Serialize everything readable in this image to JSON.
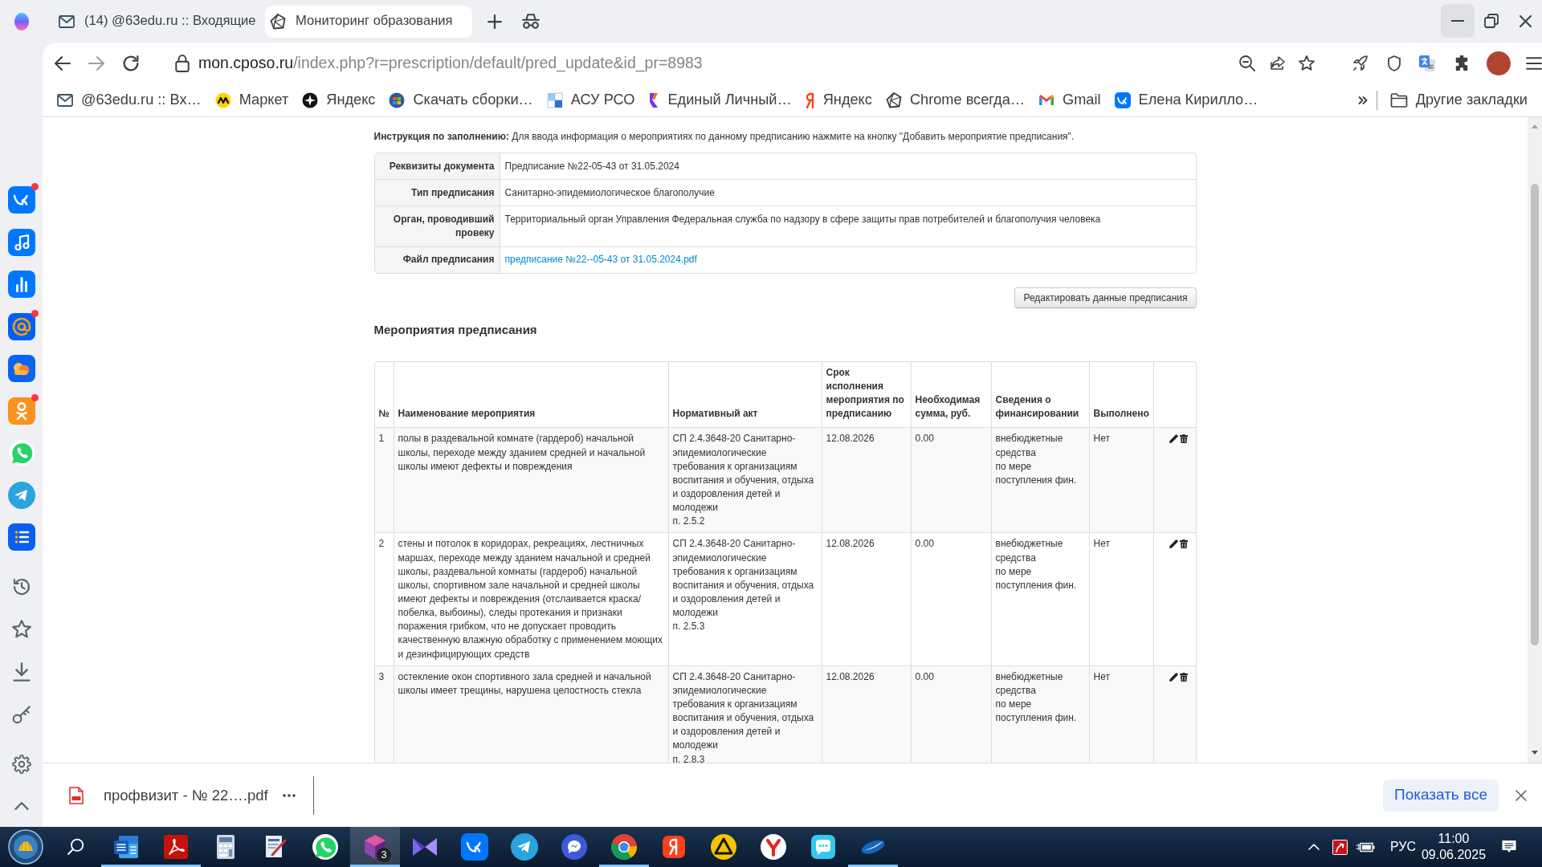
{
  "browser": {
    "tabs": [
      {
        "title": "(14) @63edu.ru :: Входящие",
        "kind": "envelope",
        "selected": false
      },
      {
        "title": "Мониторинг образования",
        "kind": "polyhedron",
        "selected": true
      }
    ],
    "window_controls": [
      {
        "kind": "minimize",
        "hovered": true
      },
      {
        "kind": "restore",
        "hovered": false
      },
      {
        "kind": "close",
        "hovered": false
      }
    ],
    "address": {
      "host": "mon.cposo.ru",
      "path": "/index.php?r=prescription/default/pred_update&id_pr=8983"
    },
    "bookmarks": [
      {
        "label": "@63edu.ru :: Вх…",
        "kind": "envelope"
      },
      {
        "label": "Маркет",
        "kind": "zigzag"
      },
      {
        "label": "Яндекс",
        "kind": "compass"
      },
      {
        "label": "Скачать сборки…",
        "kind": "globe"
      },
      {
        "label": "АСУ РСО",
        "kind": "squares"
      },
      {
        "label": "Единый Личный…",
        "kind": "ribbon"
      },
      {
        "label": "Яндекс",
        "kind": "loop"
      },
      {
        "label": "Chrome всегда…",
        "kind": "polyhedron"
      },
      {
        "label": "Gmail",
        "kind": "mail"
      },
      {
        "label": "Елена Кирилло…",
        "kind": "logo"
      }
    ],
    "other_bookmarks": "Другие закладки"
  },
  "sidebar": {
    "apps": [
      {
        "kind": "logo",
        "notification": true
      },
      {
        "kind": "note",
        "notification": false
      },
      {
        "kind": "bars",
        "notification": false
      },
      {
        "kind": "at",
        "notification": true
      },
      {
        "kind": "clouds",
        "notification": false
      },
      {
        "kind": "person",
        "notification": true
      },
      {
        "kind": "phone",
        "notification": false
      },
      {
        "kind": "plane",
        "notification": false
      },
      {
        "kind": "list",
        "notification": false
      }
    ]
  },
  "page": {
    "instruction": "**Инструкция по заполнению:** Для ввода информация о мероприятиях по данному предписанию нажмите на кнопку \"Добавить мероприятие предписания\".",
    "details": [
      {
        "label": "Реквизиты документа",
        "value": "Предписание №22-05-43 от 31.05.2024",
        "kind": "text"
      },
      {
        "label": "Тип предписания",
        "value": "Санитарно-эпидемиологическое благополучие",
        "kind": "text"
      },
      {
        "label": "Орган, проводивший провеку",
        "value": "Территориальный орган Управления Федеральная служба по надзору в сфере защиты прав потребителей и благополучия человека",
        "kind": "text"
      },
      {
        "label": "Файл предписания",
        "value": "предписание №22--05-43 от 31.05.2024.pdf",
        "kind": "link"
      }
    ],
    "edit_button": "Редактировать данные предписания",
    "events": {
      "title": "Мероприятия предписания",
      "columns": [
        "№",
        "Наименование мероприятия",
        "Нормативный акт",
        "Срок исполнения мероприятия по предписанию",
        "Необходимая сумма, руб.",
        "Сведения о финансировании",
        "Выполнено"
      ],
      "rows": [
        {
          "number": "1",
          "name": "полы в раздевальной комнате (гардероб) начальной школы, переходе между зданием средней и начальной школы имеют дефекты и повреждения",
          "act": "СП 2.4.3648-20 Санитарно-эпидемиологические требования к организациям воспитания и обучения, отдыха и оздоровления детей и молодежи",
          "clause": "п. 2.5.2",
          "deadline": "12.08.2026",
          "amount": "0.00",
          "funding": "внебюджетные средства",
          "funding_note": "по мере поступления фин.",
          "done": "Нет"
        },
        {
          "number": "2",
          "name": "стены и потолок в коридорах, рекреациях, лестничных маршах, переходе между зданием начальной и средней школы, раздевальной комнаты (гардероб) начальной школы, спортивном зале начальной и средней школы имеют дефекты и повреждения (отслаивается краска/побелка, выбоины), следы протекания и признаки поражения грибком, что не допускает проводить качественную влажную обработку с применением моющих и дезинфицирующих средств",
          "act": "СП 2.4.3648-20 Санитарно-эпидемиологические требования к организациям воспитания и обучения, отдыха и оздоровления детей и молодежи",
          "clause": "п. 2.5.3",
          "deadline": "12.08.2026",
          "amount": "0.00",
          "funding": "внебюджетные средства",
          "funding_note": "по мере поступления фин.",
          "done": "Нет"
        },
        {
          "number": "3",
          "name": "остекление окон спортивного зала средней и начальной школы имеет трещины, нарушена целостность стекла",
          "act": "СП 2.4.3648-20 Санитарно-эпидемиологические требования к организациям воспитания и обучения, отдыха и оздоровления детей и молодежи",
          "clause": "п. 2.8.3",
          "deadline": "12.08.2026",
          "amount": "0.00",
          "funding": "внебюджетные средства",
          "funding_note": "по мере поступления фин.",
          "done": "Нет"
        }
      ]
    }
  },
  "download_bar": {
    "file": "профвизит - № 22….pdf",
    "show_all": "Показать все"
  },
  "taskbar": {
    "apps": [
      {
        "kind": "document",
        "running": true,
        "selected": false
      },
      {
        "kind": "swirl",
        "running": true,
        "selected": false
      },
      {
        "kind": "calculator",
        "running": false,
        "selected": false
      },
      {
        "kind": "pen",
        "running": false,
        "selected": false
      },
      {
        "kind": "phone",
        "running": false,
        "selected": false
      },
      {
        "kind": "gem",
        "running": true,
        "selected": true,
        "badge": "3"
      },
      {
        "kind": "bowtie",
        "running": false,
        "selected": false
      },
      {
        "kind": "logo",
        "running": false,
        "selected": false
      },
      {
        "kind": "plane",
        "running": false,
        "selected": false
      },
      {
        "kind": "bubble",
        "running": false,
        "selected": false
      },
      {
        "kind": "ring",
        "running": true,
        "selected": false
      },
      {
        "kind": "mark",
        "running": false,
        "selected": false
      },
      {
        "kind": "triangle",
        "running": false,
        "selected": false
      },
      {
        "kind": "fork",
        "running": false,
        "selected": false
      },
      {
        "kind": "chat",
        "running": false,
        "selected": false
      },
      {
        "kind": "swoosh",
        "running": true,
        "selected": false
      }
    ],
    "language": "РУС",
    "time": "11:00",
    "date": "09.06.2025"
  }
}
